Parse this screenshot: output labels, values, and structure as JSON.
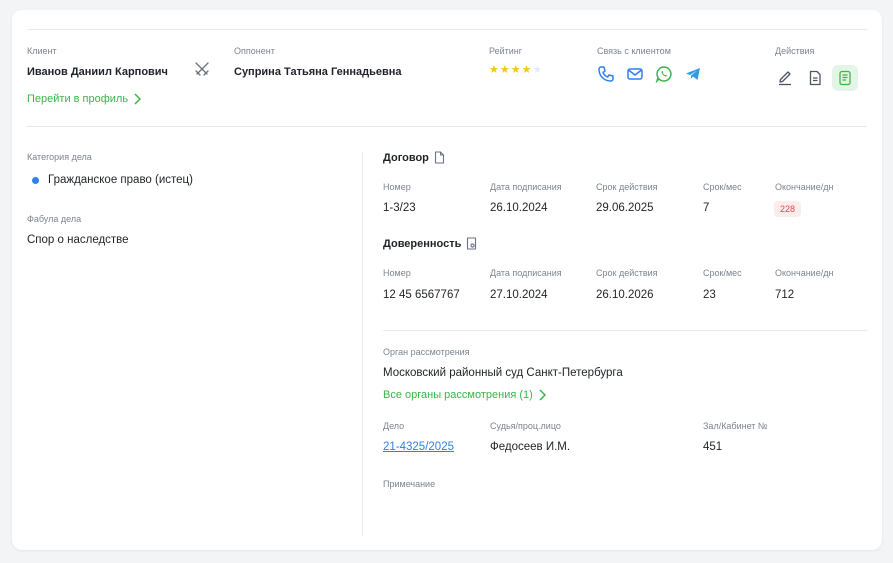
{
  "header": {
    "client_label": "Клиент",
    "client_name": "Иванов Даниил Карпович",
    "profile_link": "Перейти в профиль",
    "opponent_label": "Оппонент",
    "opponent_name": "Суприна Татьяна Геннадьевна",
    "rating_label": "Рейтинг",
    "rating_value": 4,
    "rating_max": 5,
    "contact_label": "Связь с клиентом",
    "contact_icons": [
      "phone-icon",
      "mail-icon",
      "whatsapp-icon",
      "telegram-icon"
    ],
    "actions_label": "Действия",
    "action_icons": [
      "edit-icon",
      "document-icon",
      "notes-icon"
    ]
  },
  "left": {
    "category_label": "Категория дела",
    "category_value": "Гражданское право (истец)",
    "fabula_label": "Фабула дела",
    "fabula_value": "Спор о наследстве"
  },
  "contract": {
    "title": "Договор",
    "columns": [
      "Номер",
      "Дата подписания",
      "Срок действия",
      "Срок/мес",
      "Окончание/дн"
    ],
    "values": [
      "1-3/23",
      "26.10.2024",
      "29.06.2025",
      "7",
      "228"
    ]
  },
  "power": {
    "title": "Доверенность",
    "columns": [
      "Номер",
      "Дата подписания",
      "Срок действия",
      "Срок/мес",
      "Окончание/дн"
    ],
    "values": [
      "12 45 6567767",
      "27.10.2024",
      "26.10.2026",
      "23",
      "712"
    ]
  },
  "court": {
    "organ_label": "Орган рассмотрения",
    "organ_value": "Московский районный суд Санкт-Петербурга",
    "all_organs_link": "Все органы рассмотрения (1)",
    "case_label": "Дело",
    "case_value": "21-4325/2025",
    "judge_label": "Судья/проц.лицо",
    "judge_value": "Федосеев И.М.",
    "room_label": "Зал/Кабинет №",
    "room_value": "451",
    "note_label": "Примечание"
  },
  "colors": {
    "accent_green": "#3bb54a",
    "blue": "#2f80ed",
    "star": "#f5c518",
    "badge_red": "#e5484d"
  }
}
